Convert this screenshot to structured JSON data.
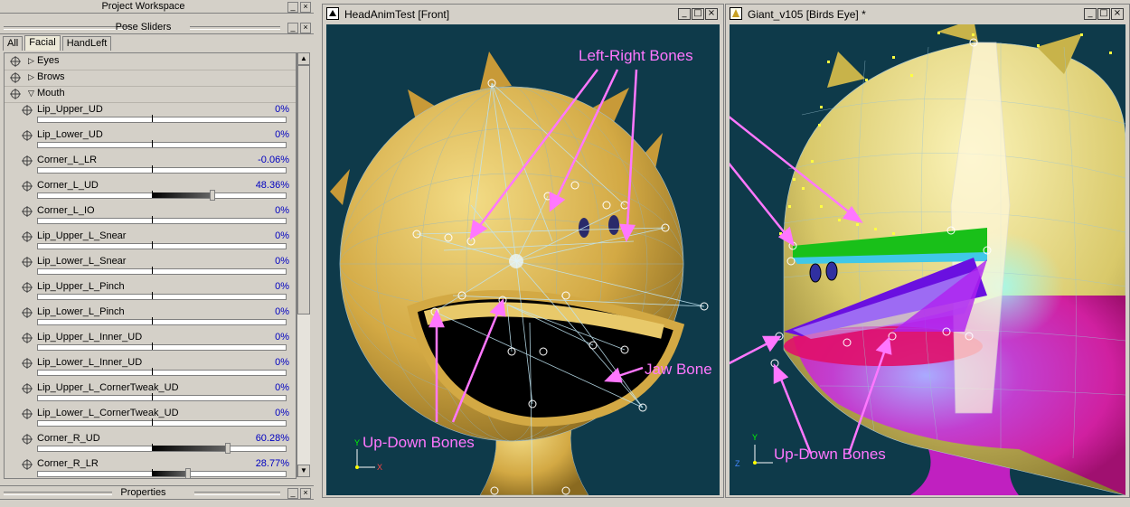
{
  "left_panel": {
    "workspace_title": "Project Workspace",
    "pose_sliders_title": "Pose Sliders",
    "properties_title": "Properties",
    "tabs": [
      {
        "label": "All",
        "active": false
      },
      {
        "label": "Facial",
        "active": true
      },
      {
        "label": "HandLeft",
        "active": false
      }
    ],
    "groups": [
      {
        "label": "Eyes",
        "expanded": false
      },
      {
        "label": "Brows",
        "expanded": false
      },
      {
        "label": "Mouth",
        "expanded": true
      }
    ],
    "sliders": [
      {
        "name": "Lip_Upper_UD",
        "value": "0%",
        "amount": 0
      },
      {
        "name": "Lip_Lower_UD",
        "value": "0%",
        "amount": 0
      },
      {
        "name": "Corner_L_LR",
        "value": "-0.06%",
        "amount": -0.0006
      },
      {
        "name": "Corner_L_UD",
        "value": "48.36%",
        "amount": 0.4836
      },
      {
        "name": "Corner_L_IO",
        "value": "0%",
        "amount": 0
      },
      {
        "name": "Lip_Upper_L_Snear",
        "value": "0%",
        "amount": 0
      },
      {
        "name": "Lip_Lower_L_Snear",
        "value": "0%",
        "amount": 0
      },
      {
        "name": "Lip_Upper_L_Pinch",
        "value": "0%",
        "amount": 0
      },
      {
        "name": "Lip_Lower_L_Pinch",
        "value": "0%",
        "amount": 0
      },
      {
        "name": "Lip_Upper_L_Inner_UD",
        "value": "0%",
        "amount": 0
      },
      {
        "name": "Lip_Lower_L_Inner_UD",
        "value": "0%",
        "amount": 0
      },
      {
        "name": "Lip_Upper_L_CornerTweak_UD",
        "value": "0%",
        "amount": 0
      },
      {
        "name": "Lip_Lower_L_CornerTweak_UD",
        "value": "0%",
        "amount": 0
      },
      {
        "name": "Corner_R_UD",
        "value": "60.28%",
        "amount": 0.6028
      },
      {
        "name": "Corner_R_LR",
        "value": "28.77%",
        "amount": 0.2877
      }
    ]
  },
  "viewport_front": {
    "title": "HeadAnimTest [Front]",
    "annotations": {
      "up_down": "Up-Down Bones",
      "jaw": "Jaw Bone"
    }
  },
  "viewport_birds": {
    "title": "Giant_v105 [Birds Eye] *",
    "annotations": {
      "up_down": "Up-Down Bones",
      "left_right": "Left-Right Bones"
    }
  },
  "axes": {
    "x": "X",
    "y": "Y",
    "z": "Z"
  },
  "window_buttons": {
    "minimize": "_",
    "restore": "□",
    "close": "×"
  },
  "colors": {
    "annotation": "#ff77ff",
    "viewport_bg": "#0e3a4a",
    "head": "#d9b44a"
  }
}
